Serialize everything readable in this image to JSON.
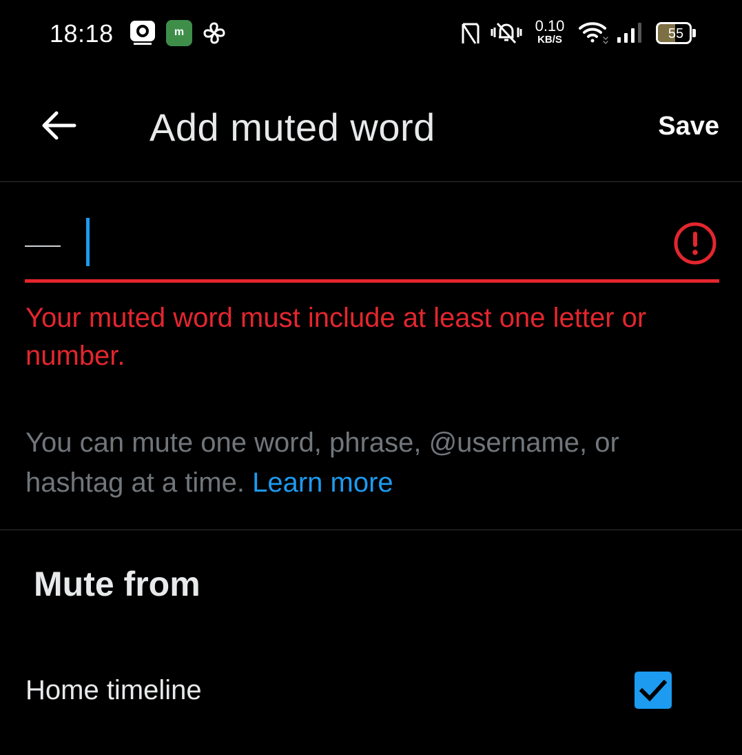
{
  "status_bar": {
    "time": "18:18",
    "app_icons": [
      "philips-icon",
      "m-app-icon",
      "fan-icon"
    ],
    "m_app_letter": "m",
    "net_speed_value": "0.10",
    "net_speed_unit": "KB/S",
    "battery_level": "55",
    "battery_fraction": 0.55,
    "icons": [
      "nfc-icon",
      "vibrate-icon",
      "wifi-icon",
      "signal-icon",
      "battery-icon"
    ]
  },
  "header": {
    "back_icon": "arrow-left-icon",
    "title": "Add muted word",
    "save_label": "Save"
  },
  "input": {
    "value": "",
    "error_icon": "exclamation-circle-icon",
    "error_message": "Your muted word must include at least one letter or number."
  },
  "hint": {
    "text": "You can mute one word, phrase, @username, or hashtag at a time. ",
    "link_label": "Learn more"
  },
  "mute_from": {
    "heading": "Mute from",
    "options": [
      {
        "label": "Home timeline",
        "checked": true
      }
    ]
  },
  "colors": {
    "background": "#000000",
    "error": "#e4262e",
    "accent": "#1d9bf0",
    "muted_text": "#71767b",
    "text": "#e7e9ea",
    "divider": "#2f3336"
  }
}
